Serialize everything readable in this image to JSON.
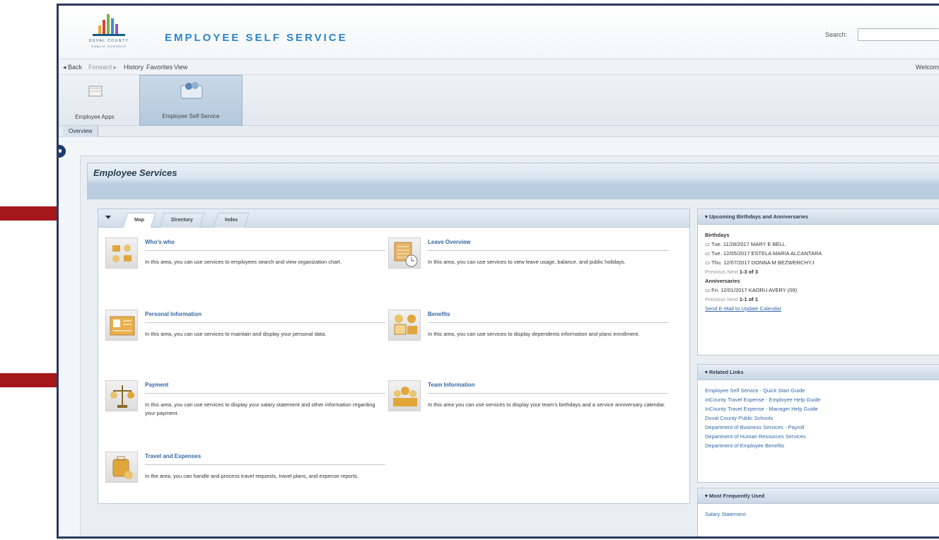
{
  "header": {
    "logo_line1": "DUVAL COUNTY",
    "logo_line2": "PUBLIC SCHOOLS",
    "app_title": "EMPLOYEE SELF SERVICE",
    "search_label": "Search:"
  },
  "nav": {
    "back": "◂ Back",
    "forward": "Forward ▸",
    "history": "History",
    "favorites": "Favorites",
    "view": "View",
    "welcome": "Welcome"
  },
  "roles": [
    {
      "label": "Employee Apps",
      "icon": "folder-icon"
    },
    {
      "label": "Employee Self-Service",
      "icon": "people-icon"
    }
  ],
  "subnav": {
    "overview": "Overview"
  },
  "page_title": "Employee Services",
  "tabs": [
    "Map",
    "Directory",
    "Index"
  ],
  "services": [
    {
      "title": "Who's who",
      "desc": "In this area, you can use services to employees search and view organization chart.",
      "icon": "org-icon"
    },
    {
      "title": "Leave Overview",
      "desc": "In this area, you can use services to view leave usage, balance, and public holidays.",
      "icon": "calendar-icon"
    },
    {
      "title": "Personal Information",
      "desc": "In this area, you can use services to maintain and display your personal data.",
      "icon": "id-card-icon"
    },
    {
      "title": "Benefits",
      "desc": "In this area, you can use services to display dependents information and plans enrollment.",
      "icon": "benefits-icon"
    },
    {
      "title": "Payment",
      "desc": "In this area, you can use services to display your salary statement and other information regarding your payment.",
      "icon": "payment-icon"
    },
    {
      "title": "Team Information",
      "desc": "In this area you can use services to display your team's birthdays and a service anniversary calendar.",
      "icon": "team-icon"
    },
    {
      "title": "Travel and Expenses",
      "desc": "In the area, you can handle and process travel requests, travel plans, and expense reports.",
      "icon": "travel-icon"
    }
  ],
  "birthdays_panel": {
    "title": "Upcoming Birthdays and Anniversaries",
    "birthdays_label": "Birthdays",
    "birthdays": [
      "Tue. 11/28/2017 MARY E BELL",
      "Tue. 12/05/2017 ESTELA MARIA ALCANTARA",
      "Thu. 12/07/2017 DONNA M BEZWERCHYJ"
    ],
    "prev": "Previous",
    "next": "Next",
    "birthdays_count": "1-3 of 3",
    "anniversaries_label": "Anniversaries",
    "anniversaries": [
      "Fri. 12/01/2017 KAORU AVERY (09)"
    ],
    "anniversaries_count": "1-1 of 1",
    "email_link": "Send E-Mail to Update Calendar"
  },
  "related_panel": {
    "title": "Related Links",
    "links": [
      "Employee Self Service - Quick Start Guide",
      "InCounty Travel Expense - Employee Help Guide",
      "InCounty Travel Expense - Manager Help Guide",
      "Duval County Public Schools",
      "Department of Business Services - Payroll",
      "Department of Human Resources Services",
      "Department of Employee Benefits"
    ]
  },
  "frequent_panel": {
    "title": "Most Frequently Used",
    "items": [
      "Salary Statement"
    ]
  },
  "colors": {
    "arrow": "#a4181c",
    "link": "#3567a3",
    "title": "#2a86c8",
    "frame": "#2b3a5c"
  }
}
